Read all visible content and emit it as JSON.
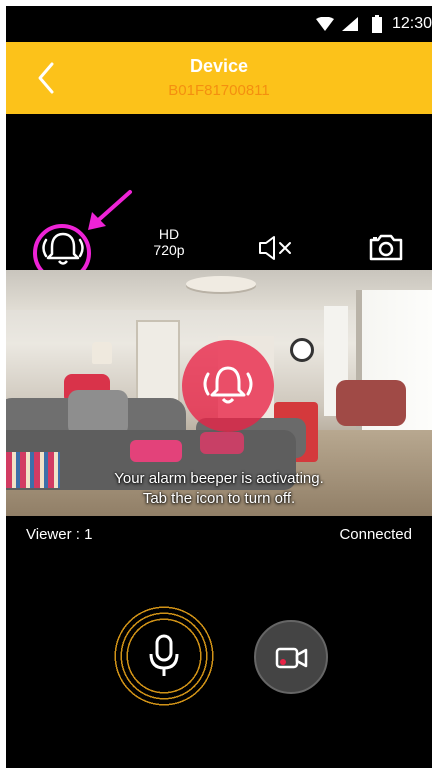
{
  "status_bar": {
    "time": "12:30",
    "icons": [
      "wifi-icon",
      "signal-icon",
      "battery-icon"
    ]
  },
  "header": {
    "title": "Device",
    "device_id": "B01F81700811",
    "accent_color": "#fcc21a",
    "subtitle_color": "#f48f10"
  },
  "toolbar": {
    "alarm_icon": "alarm-bell-icon",
    "hd_label": "HD",
    "resolution": "720p",
    "mute_icon": "speaker-muted-icon",
    "snapshot_icon": "camera-icon"
  },
  "video": {
    "overlay_line1": "Your alarm beeper is activating.",
    "overlay_line2": "Tab the icon to turn off.",
    "overlay_color": "#e92246"
  },
  "info": {
    "viewer_label": "Viewer : 1",
    "connection_status": "Connected"
  },
  "controls": {
    "mic_icon": "microphone-icon",
    "record_icon": "video-record-icon"
  },
  "annotation": {
    "highlight_color": "#ee23d6"
  }
}
